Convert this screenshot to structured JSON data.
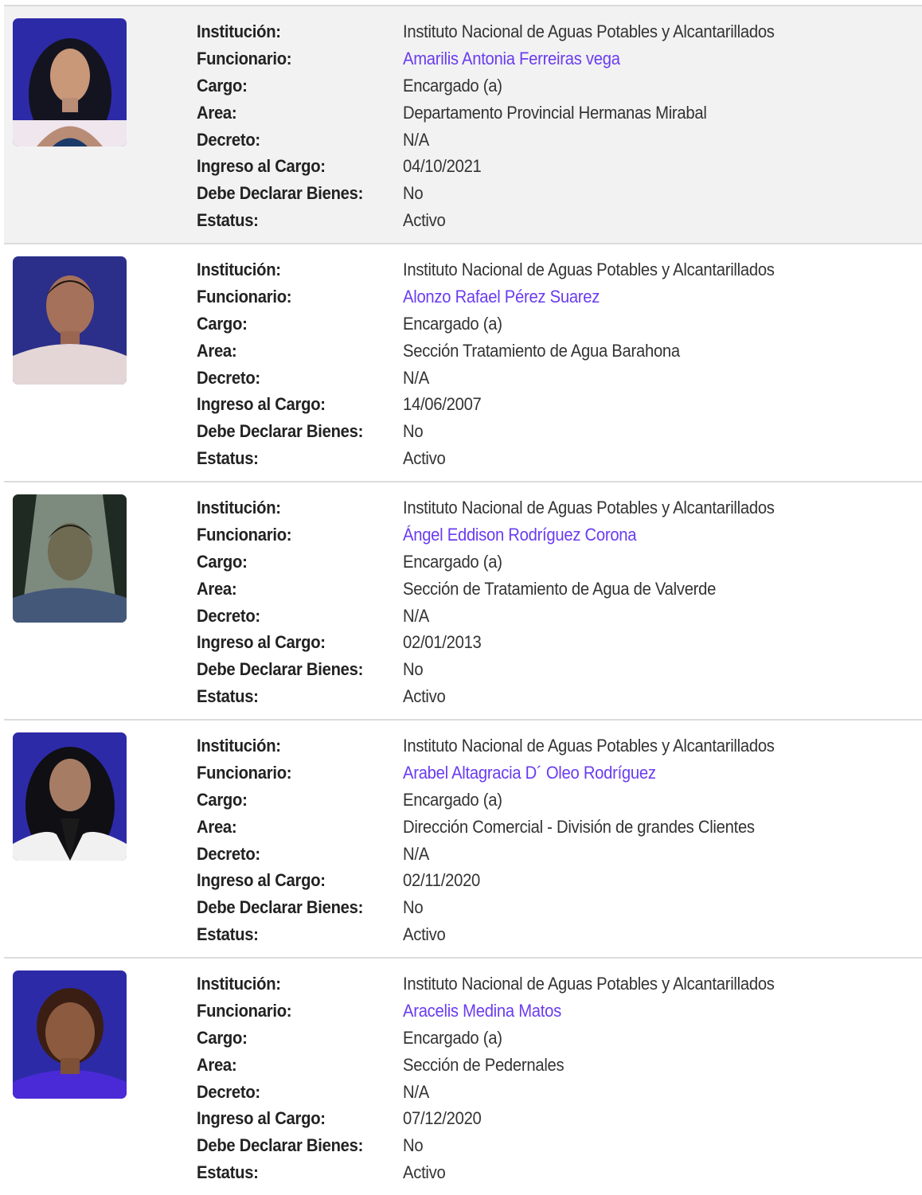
{
  "labels": {
    "institucion": "Institución:",
    "funcionario": "Funcionario:",
    "cargo": "Cargo:",
    "area": "Area:",
    "decreto": "Decreto:",
    "ingreso": "Ingreso al Cargo:",
    "declarar": "Debe Declarar Bienes:",
    "estatus": "Estatus:"
  },
  "records": [
    {
      "institucion": "Instituto Nacional de Aguas Potables y Alcantarillados",
      "funcionario": "Amarilis Antonia Ferreiras vega",
      "cargo": "Encargado (a)",
      "area": "Departamento Provincial Hermanas Mirabal",
      "decreto": "N/A",
      "ingreso": "04/10/2021",
      "declarar": "No",
      "estatus": "Activo"
    },
    {
      "institucion": "Instituto Nacional de Aguas Potables y Alcantarillados",
      "funcionario": "Alonzo Rafael Pérez Suarez",
      "cargo": "Encargado (a)",
      "area": "Sección Tratamiento de Agua Barahona",
      "decreto": "N/A",
      "ingreso": "14/06/2007",
      "declarar": "No",
      "estatus": "Activo"
    },
    {
      "institucion": "Instituto Nacional de Aguas Potables y Alcantarillados",
      "funcionario": "Ángel Eddison Rodríguez Corona",
      "cargo": "Encargado (a)",
      "area": "Sección de Tratamiento de Agua de Valverde",
      "decreto": "N/A",
      "ingreso": "02/01/2013",
      "declarar": "No",
      "estatus": "Activo"
    },
    {
      "institucion": "Instituto Nacional de Aguas Potables y Alcantarillados",
      "funcionario": "Arabel Altagracia D´ Oleo Rodríguez",
      "cargo": "Encargado (a)",
      "area": "Dirección Comercial - División de grandes Clientes",
      "decreto": "N/A",
      "ingreso": "02/11/2020",
      "declarar": "No",
      "estatus": "Activo"
    },
    {
      "institucion": "Instituto Nacional de Aguas Potables y Alcantarillados",
      "funcionario": "Aracelis Medina Matos",
      "cargo": "Encargado (a)",
      "area": "Sección de Pedernales",
      "decreto": "N/A",
      "ingreso": "07/12/2020",
      "declarar": "No",
      "estatus": "Activo"
    }
  ]
}
